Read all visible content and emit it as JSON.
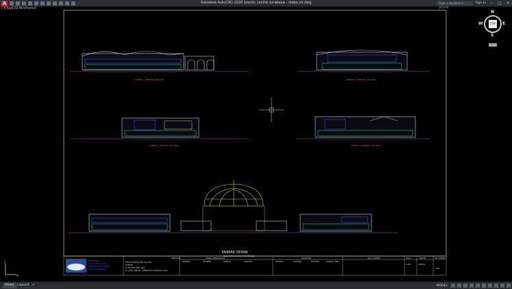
{
  "app": {
    "title": "Autodesk AutoCAD 2020    islamic centre surabaya - rodeo ok.dwg",
    "logo_letter": "A",
    "search_placeholder": "Type a keyword or phrase",
    "sign_in": "Sign In"
  },
  "viewport": {
    "label": "[-][Top][2D Wireframe]"
  },
  "compass": {
    "north": "N",
    "south": "S",
    "east": "E",
    "west": "W",
    "cube": "TOP"
  },
  "drawing": {
    "labels": [
      "TAMPAK 1 GEDUNG SELATAN",
      "TAMPAK 4 GEDUNG SELATAN",
      "TAMPAK 2 GEDUNG SELATAN",
      "TAMPAK 3 GEDUNG SELATAN"
    ],
    "main_label": "TAMPAK DEPAN",
    "main_sublabel": "SKALA 1:500 (TAMPAK PLAZA/RUANG)",
    "title_block": {
      "client": [
        "PEMERINTAH",
        "BADAN PELAKSANA",
        "PEMBANGUNAN MASJID",
        "WILAYAH SURABAYA"
      ],
      "project_title": [
        "PENYUSUNAN DED ISLAMIC",
        "CENTER",
        "DI MASJID RESI ARIA",
        "JL. JOKO JUMADI, JOMBATAN SURABAYA 2021"
      ],
      "headers": [
        "PEKERJAAN",
        "TENAGA PENGAWASAN",
        "KONSULTAN",
        "JUDUL GAMBAR",
        "SKALA",
        "NOMOR",
        "NO. GAMBAR"
      ],
      "columns": [
        "DIPERIKSA",
        "DIGAMBAR",
        "DISETUJUI",
        "DISAHKAN",
        "DIPERIKSA",
        "DIGAMBAR",
        "DIKETAHUI",
        "DISETUJUI TOBEL"
      ],
      "drawing_title": "TAMPAK",
      "scale": "1:500",
      "sheet": "ARS"
    }
  },
  "statusbar": {
    "tabs": [
      "Model",
      "Layout1",
      "+"
    ],
    "model_label": "MODEL"
  }
}
